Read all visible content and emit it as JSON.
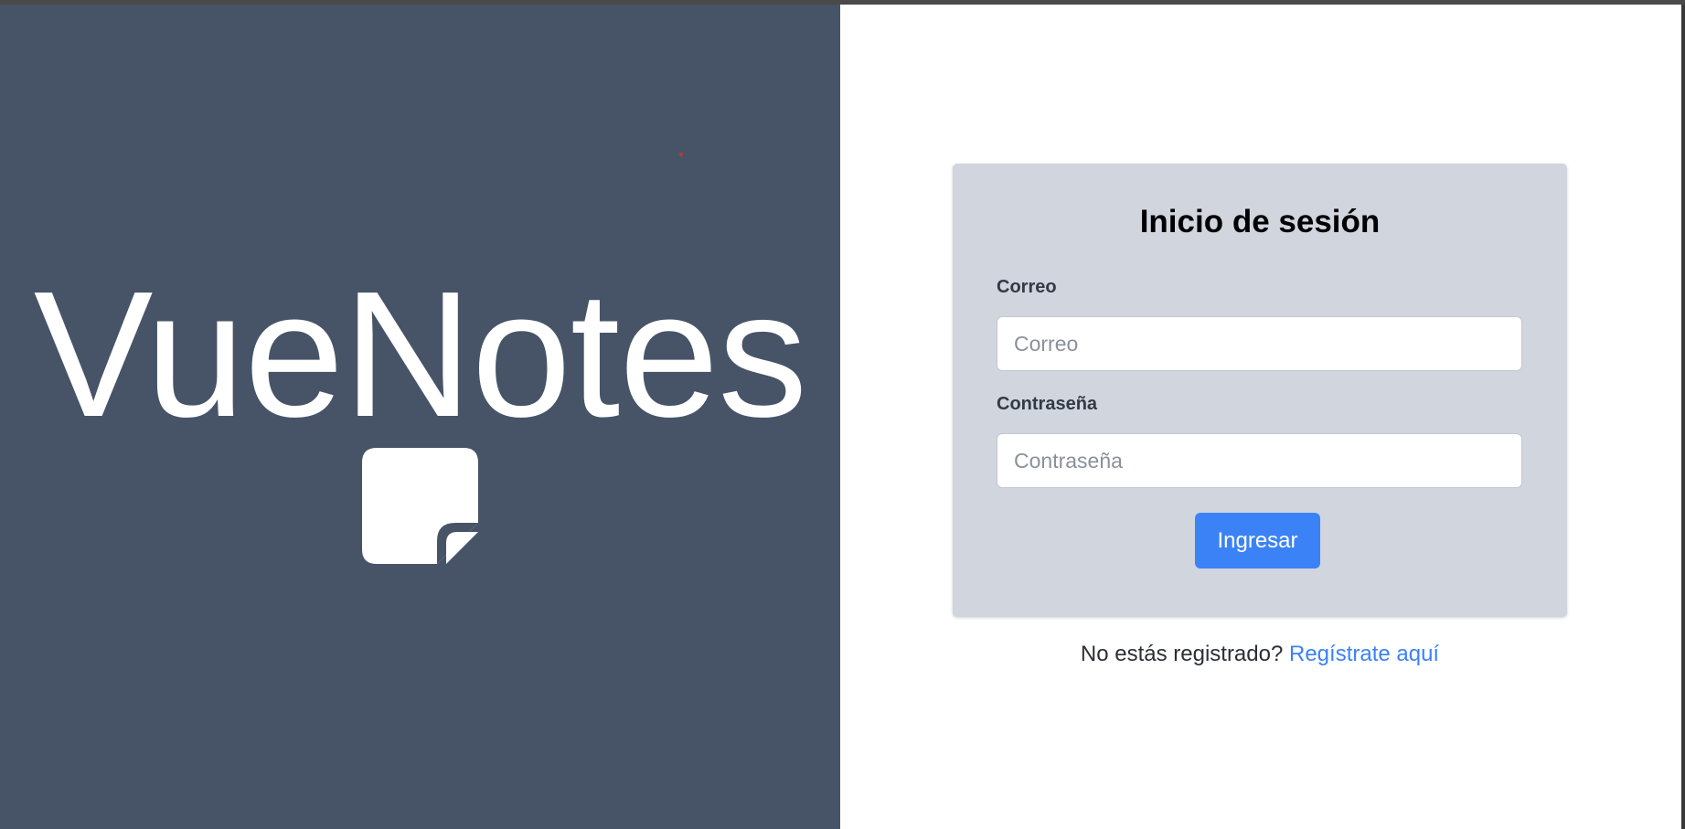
{
  "brand": {
    "title": "VueNotes",
    "icon": "sticky-note-icon"
  },
  "login": {
    "title": "Inicio de sesión",
    "email": {
      "label": "Correo",
      "placeholder": "Correo",
      "value": ""
    },
    "password": {
      "label": "Contraseña",
      "placeholder": "Contraseña",
      "value": ""
    },
    "submit_label": "Ingresar"
  },
  "register": {
    "prompt": "No estás registrado?",
    "link_label": "Regístrate aquí"
  },
  "colors": {
    "brand_panel": "#475467",
    "card": "#d1d5de",
    "accent": "#3b82f6"
  }
}
